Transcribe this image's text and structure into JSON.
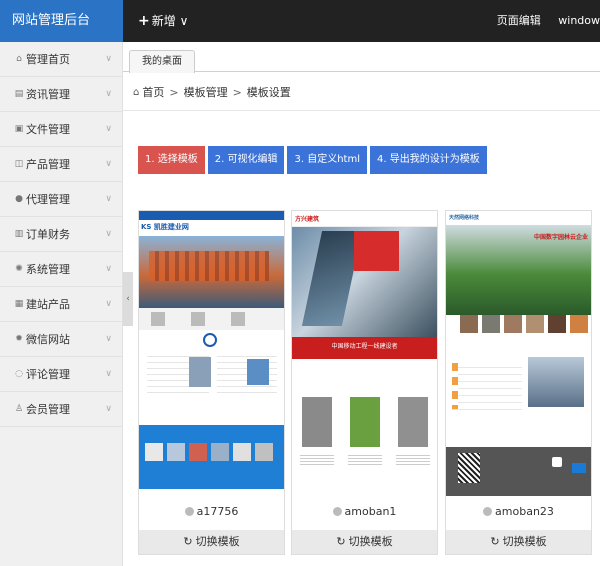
{
  "header": {
    "logo": "网站管理后台",
    "new_label": "新增",
    "right_links": [
      "页面编辑",
      "window"
    ]
  },
  "sidebar": {
    "items": [
      {
        "label": "管理首页",
        "icon": "home-icon"
      },
      {
        "label": "资讯管理",
        "icon": "news-icon"
      },
      {
        "label": "文件管理",
        "icon": "file-icon"
      },
      {
        "label": "产品管理",
        "icon": "product-icon"
      },
      {
        "label": "代理管理",
        "icon": "user-icon"
      },
      {
        "label": "订单财务",
        "icon": "order-icon"
      },
      {
        "label": "系统管理",
        "icon": "gear-icon"
      },
      {
        "label": "建站产品",
        "icon": "build-icon"
      },
      {
        "label": "微信网站",
        "icon": "wechat-icon"
      },
      {
        "label": "评论管理",
        "icon": "comment-icon"
      },
      {
        "label": "会员管理",
        "icon": "member-icon"
      }
    ]
  },
  "tab": {
    "label": "我的桌面"
  },
  "breadcrumb": [
    "首页",
    "模板管理",
    "模板设置"
  ],
  "steps": [
    {
      "label": "1. 选择模板",
      "color": "#d9534f"
    },
    {
      "label": "2. 可视化编辑",
      "color": "#3b73d9"
    },
    {
      "label": "3. 自定义html",
      "color": "#3b73d9"
    },
    {
      "label": "4. 导出我的设计为模板",
      "color": "#3b73d9"
    }
  ],
  "templates": [
    {
      "name": "a17756",
      "switch_label": "切换模板",
      "thumb_brand": "KS 凯胜建业网",
      "thumb_banner": ""
    },
    {
      "name": "amoban1",
      "switch_label": "切换模板",
      "thumb_brand": "方兴建筑",
      "thumb_banner": "中国移动工程一线建设者"
    },
    {
      "name": "amoban23",
      "switch_label": "切换模板",
      "thumb_brand": "天然网络科技",
      "thumb_banner": "中国数字园林云企业"
    }
  ]
}
